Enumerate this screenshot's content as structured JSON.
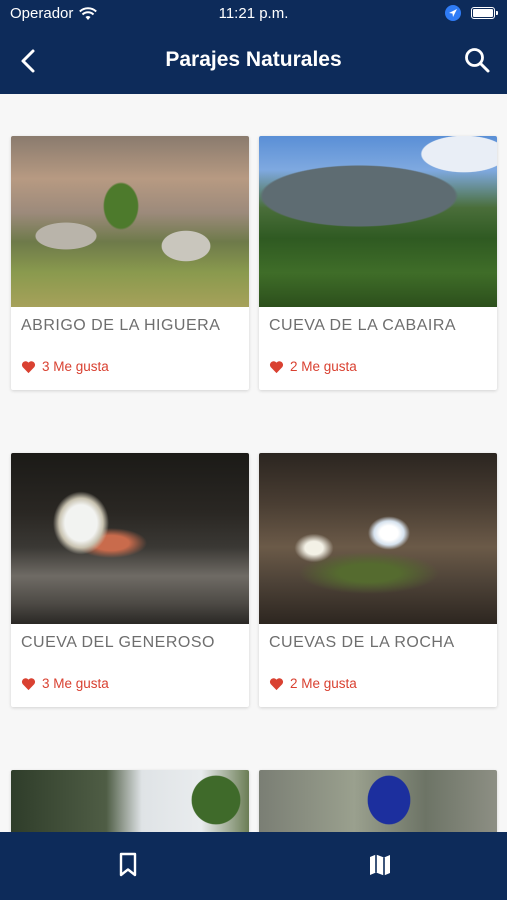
{
  "status_bar": {
    "carrier": "Operador",
    "time": "11:21 p.m."
  },
  "navbar": {
    "title": "Parajes Naturales",
    "back_icon": "chevron-left-icon",
    "search_icon": "search-icon"
  },
  "colors": {
    "primary": "#0d2b5a",
    "like": "#d94131",
    "card_title": "#6e6e6e"
  },
  "places": [
    {
      "name": "ABRIGO DE LA HIGUERA",
      "likes": "3 Me gusta"
    },
    {
      "name": "CUEVA DE LA CABAIRA",
      "likes": "2 Me gusta"
    },
    {
      "name": "CUEVA DEL GENEROSO",
      "likes": "3 Me gusta"
    },
    {
      "name": "CUEVAS DE LA ROCHA",
      "likes": "2 Me gusta"
    }
  ],
  "tabbar": {
    "items": [
      {
        "icon": "bookmark-icon"
      },
      {
        "icon": "map-icon"
      }
    ]
  }
}
